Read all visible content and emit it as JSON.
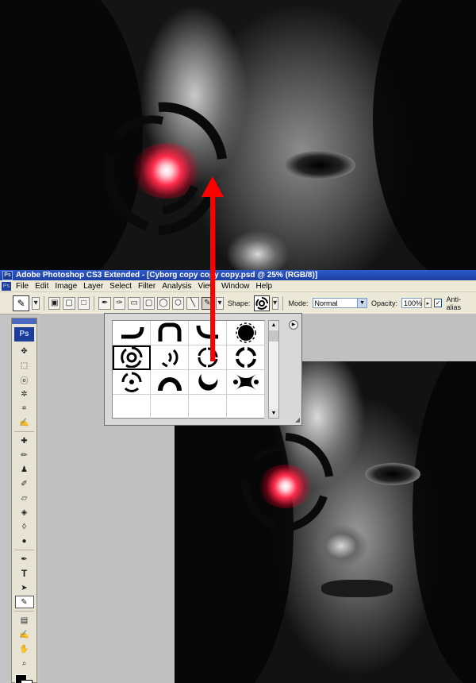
{
  "window": {
    "app_badge": "Ps",
    "title": "Adobe Photoshop CS3 Extended - [Cyborg copy copy copy.psd @ 25% (RGB/8)]"
  },
  "menubar": {
    "items": [
      "File",
      "Edit",
      "Image",
      "Layer",
      "Select",
      "Filter",
      "Analysis",
      "View",
      "Window",
      "Help"
    ]
  },
  "options": {
    "shape_label": "Shape:",
    "mode_label": "Mode:",
    "mode_value": "Normal",
    "opacity_label": "Opacity:",
    "opacity_value": "100%",
    "antialias_label": "Anti-alias",
    "antialias_checked": true
  },
  "toolbox": {
    "logo": "Ps",
    "tools": [
      "move-tool",
      "marquee-tool",
      "lasso-tool",
      "magic-wand-tool",
      "crop-tool",
      "eyedropper-tool",
      "healing-brush-tool",
      "brush-tool",
      "clone-stamp-tool",
      "history-brush-tool",
      "eraser-tool",
      "paint-bucket-tool",
      "blur-tool",
      "dodge-tool",
      "pen-tool",
      "type-tool",
      "path-selection-tool",
      "custom-shape-tool",
      "notes-tool",
      "eyedropper-tool-2",
      "hand-tool",
      "zoom-tool"
    ]
  },
  "colors": {
    "accent_arrow": "#ff0000",
    "titlebar": "#1d3f9f",
    "eye_glow": "#ff2a4a"
  },
  "shape_picker": {
    "selected_index": 4,
    "shapes": [
      "arc-curve",
      "rounded-bracket",
      "quarter-arc",
      "dotted-circle",
      "broken-rings",
      "arc-strokes",
      "broken-circle",
      "segment-circle",
      "dotted-rings",
      "semicircle-ring",
      "crescent",
      "four-point-star"
    ]
  }
}
